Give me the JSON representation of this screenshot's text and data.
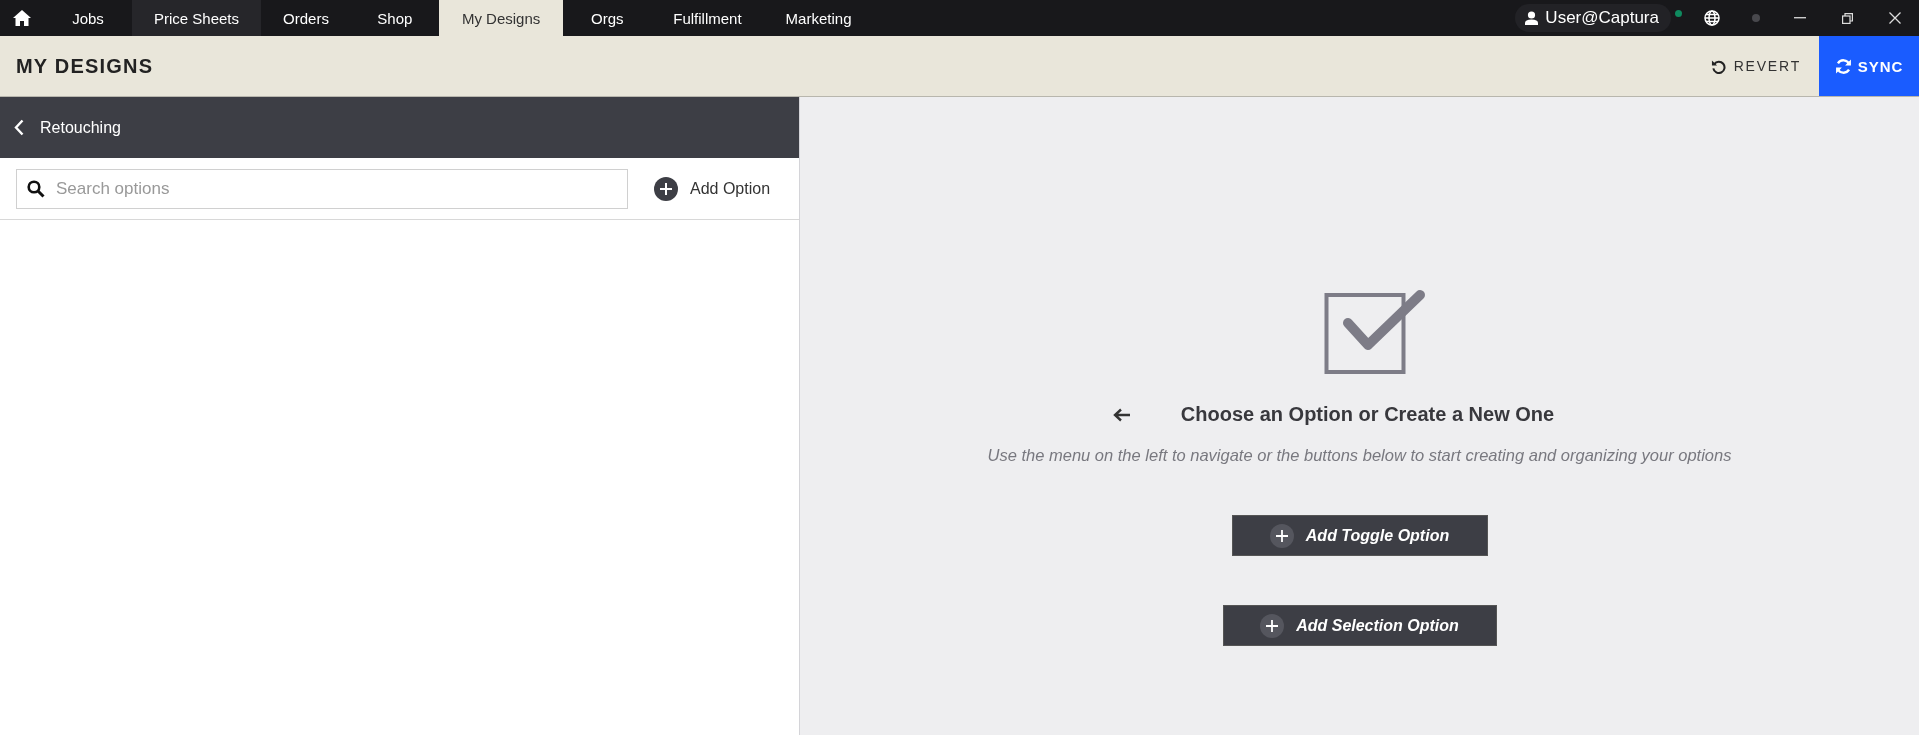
{
  "top_nav": {
    "tabs": [
      {
        "label": "Jobs",
        "selected": false,
        "hovered": false
      },
      {
        "label": "Price Sheets",
        "selected": false,
        "hovered": true
      },
      {
        "label": "Orders",
        "selected": false,
        "hovered": false
      },
      {
        "label": "Shop",
        "selected": false,
        "hovered": false
      },
      {
        "label": "My Designs",
        "selected": true,
        "hovered": false
      },
      {
        "label": "Orgs",
        "selected": false,
        "hovered": false
      },
      {
        "label": "Fulfillment",
        "selected": false,
        "hovered": false
      },
      {
        "label": "Marketing",
        "selected": false,
        "hovered": false
      }
    ],
    "user": {
      "name": "User@Captura",
      "online": true
    }
  },
  "header": {
    "title": "MY DESIGNS",
    "revert": "REVERT",
    "sync": "SYNC"
  },
  "left_panel": {
    "title": "Retouching",
    "search": {
      "placeholder": "Search options"
    },
    "add_button": "Add Option"
  },
  "empty_state": {
    "heading": "Choose an Option or Create a New One",
    "subtitle": "Use the menu on the left to navigate or the buttons below to start creating and organizing your options",
    "buttons": [
      {
        "label": "Add Toggle Option"
      },
      {
        "label": "Add Selection Option"
      }
    ]
  }
}
